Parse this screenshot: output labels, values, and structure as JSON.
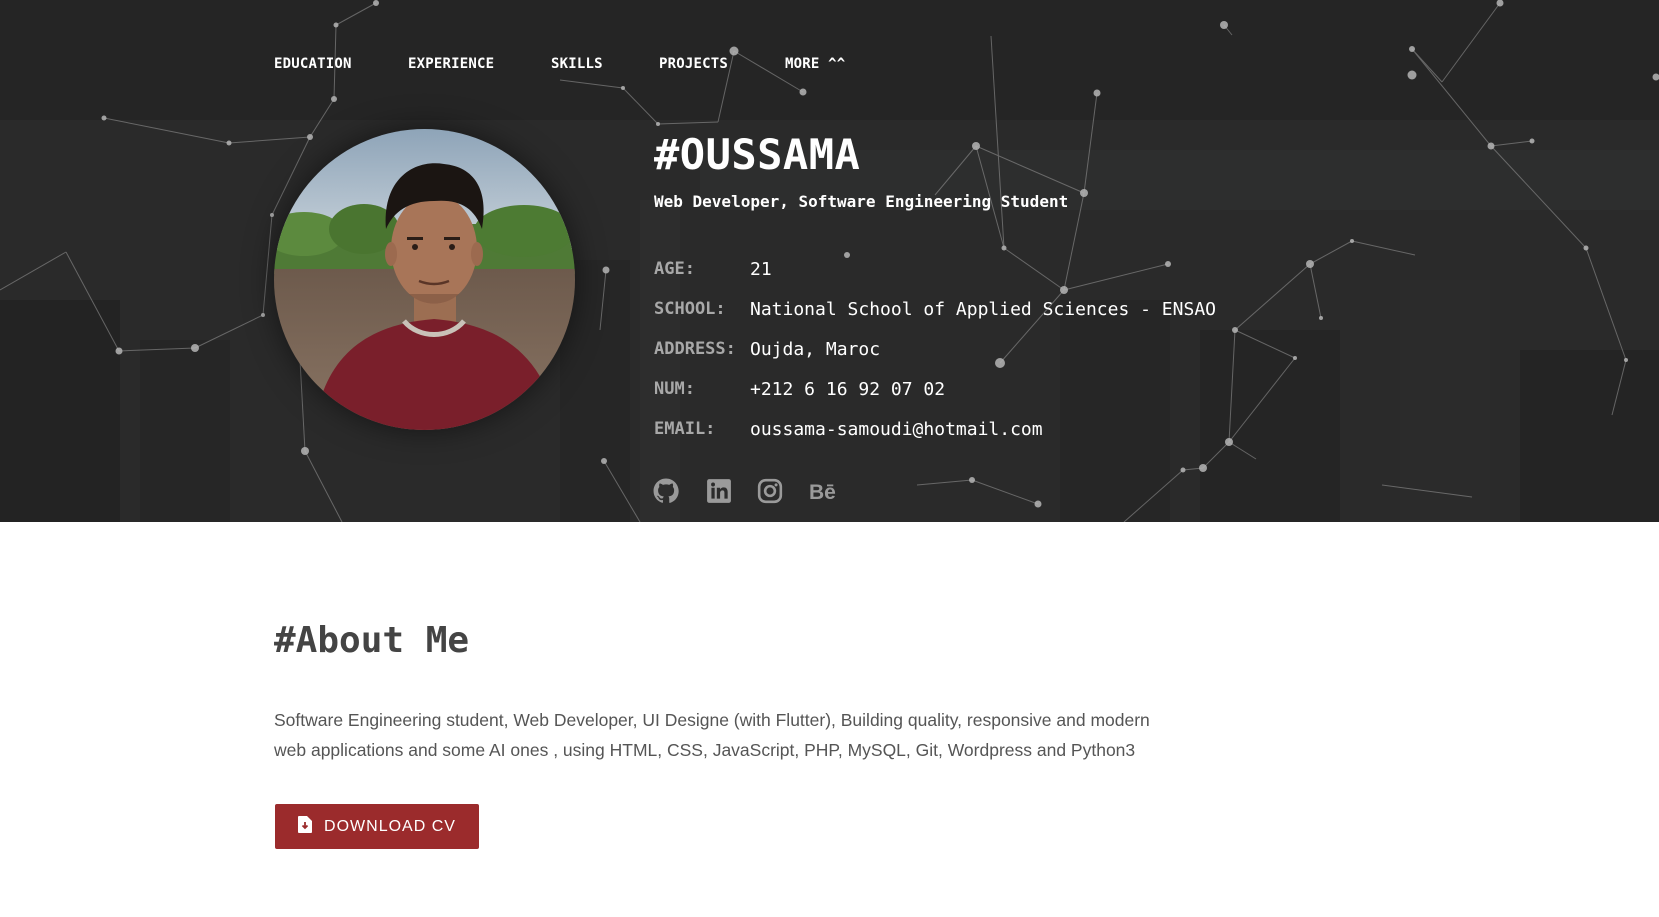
{
  "nav": {
    "items": [
      {
        "label": "EDUCATION"
      },
      {
        "label": "EXPERIENCE"
      },
      {
        "label": "SKILLS"
      },
      {
        "label": "PROJECTS"
      },
      {
        "label": "MORE ^^"
      }
    ]
  },
  "profile": {
    "name": "#OUSSAMA",
    "subtitle": "Web Developer, Software Engineering Student",
    "info": [
      {
        "label": "AGE:",
        "value": "21"
      },
      {
        "label": "SCHOOL:",
        "value": "National School of Applied Sciences - ENSAO"
      },
      {
        "label": "ADDRESS:",
        "value": "Oujda, Maroc"
      },
      {
        "label": "NUM:",
        "value": "+212 6 16 92 07 02"
      },
      {
        "label": "EMAIL:",
        "value": "oussama-samoudi@hotmail.com"
      }
    ],
    "social": [
      "github-icon",
      "linkedin-icon",
      "instagram-icon",
      "behance-icon"
    ]
  },
  "about": {
    "title": "#About Me",
    "text": "Software Engineering student, Web Developer, UI Designe (with Flutter), Building quality, responsive and modern web applications and some AI ones , using HTML, CSS, JavaScript, PHP, MySQL, Git, Wordpress and Python3",
    "download_label": "DOWNLOAD CV"
  },
  "colors": {
    "accent": "#9b2b2c",
    "hero_bg": "#2b2b2b",
    "label_gray": "#a8a8a8"
  }
}
